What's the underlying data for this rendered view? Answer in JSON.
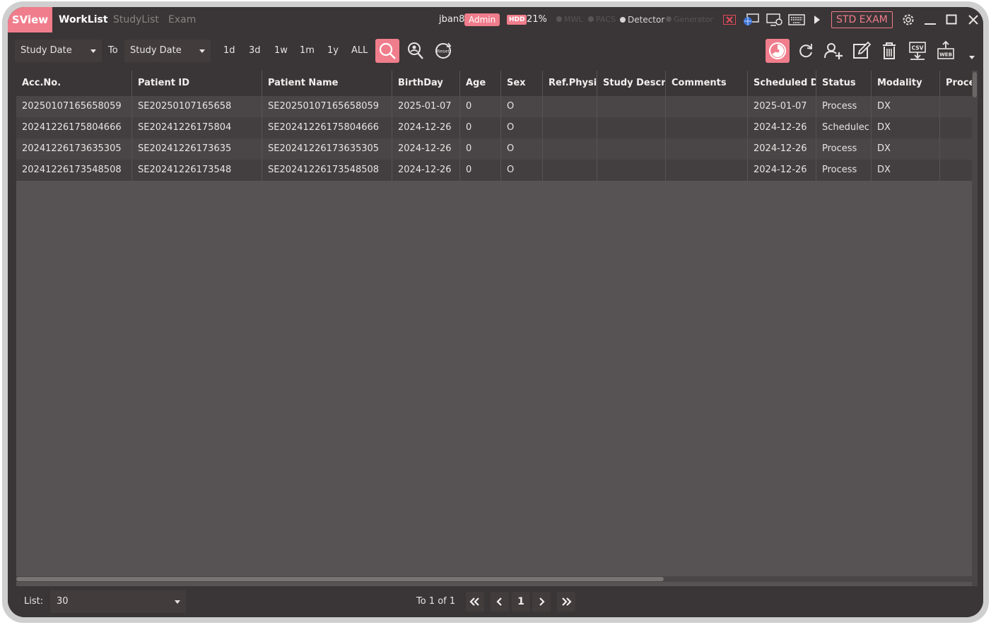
{
  "app": {
    "logo": "SView",
    "tabs": [
      {
        "label": "WorkList",
        "active": true
      },
      {
        "label": "StudyList",
        "active": false
      },
      {
        "label": "Exam",
        "active": false
      }
    ],
    "user": "jban8",
    "role": "Admin",
    "hdd_label": "HDD",
    "hdd_usage": "21%",
    "status_indicators": [
      {
        "label": "MWL",
        "active": false
      },
      {
        "label": "PACS",
        "active": false
      },
      {
        "label": "Detector",
        "active": true
      },
      {
        "label": "Generator",
        "active": false
      }
    ],
    "std_exam_label": "STD EXAM",
    "accent_color": "#f07d8c"
  },
  "toolbar": {
    "from_field": "Study Date",
    "to_label": "To",
    "to_field": "Study Date",
    "ranges": [
      "1d",
      "3d",
      "1w",
      "1m",
      "1y",
      "ALL"
    ],
    "reset_label": "Reset",
    "csv_label": "CSV",
    "web_label": "WEB"
  },
  "grid": {
    "columns": [
      "Acc.No.",
      "Patient ID",
      "Patient Name",
      "BirthDay",
      "Age",
      "Sex",
      "Ref.Physi",
      "Study Descri",
      "Comments",
      "Scheduled D",
      "Status",
      "Modality",
      "Proce"
    ],
    "rows": [
      [
        "20250107165658059",
        "SE20250107165658",
        "SE20250107165658059",
        "2025-01-07",
        "0",
        "O",
        "",
        "",
        "",
        "2025-01-07",
        "Process",
        "DX",
        ""
      ],
      [
        "20241226175804666",
        "SE20241226175804",
        "SE20241226175804666",
        "2024-12-26",
        "0",
        "O",
        "",
        "",
        "",
        "2024-12-26",
        "Schedulec",
        "DX",
        ""
      ],
      [
        "20241226173635305",
        "SE20241226173635",
        "SE20241226173635305",
        "2024-12-26",
        "0",
        "O",
        "",
        "",
        "",
        "2024-12-26",
        "Process",
        "DX",
        ""
      ],
      [
        "20241226173548508",
        "SE20241226173548",
        "SE20241226173548508",
        "2024-12-26",
        "0",
        "O",
        "",
        "",
        "",
        "2024-12-26",
        "Process",
        "DX",
        ""
      ]
    ]
  },
  "footer": {
    "list_label": "List:",
    "list_value": "30",
    "page_info": "To 1 of 1",
    "current_page": "1"
  }
}
